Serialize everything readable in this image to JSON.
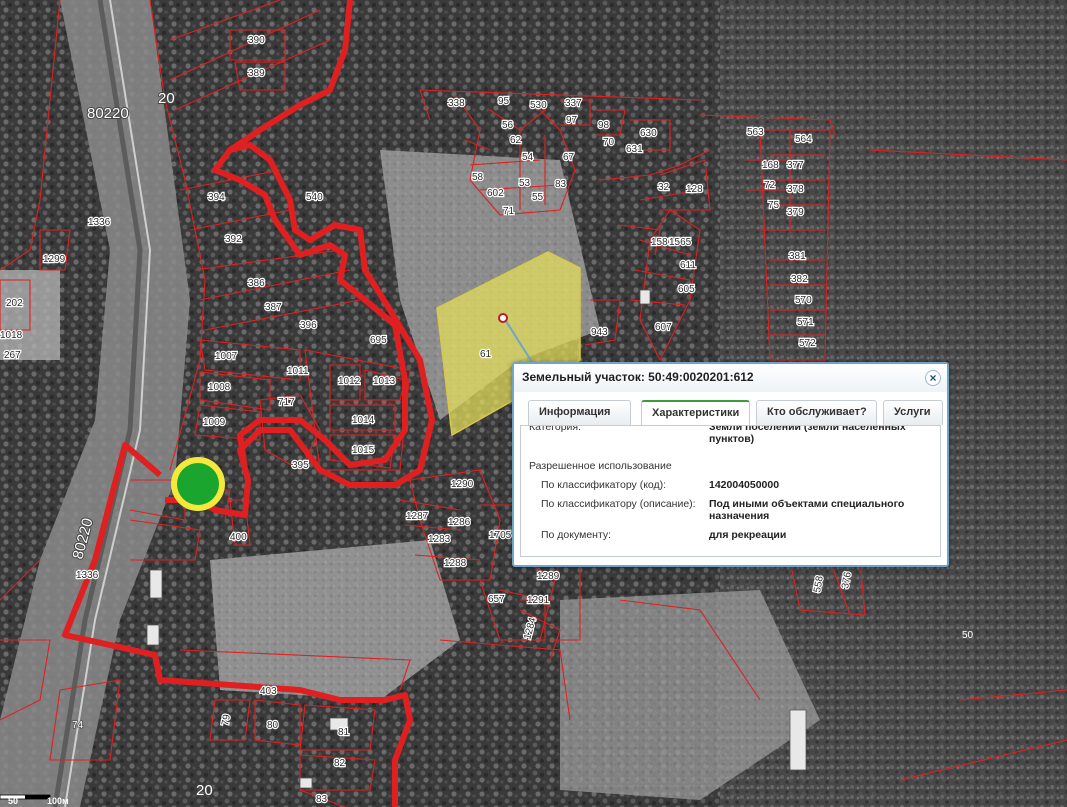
{
  "map": {
    "labels": {
      "l80220a": "80220",
      "l80220b": "80220",
      "r20a": "20",
      "r20b": "20",
      "p390": "390",
      "p389": "389",
      "p394": "394",
      "p392": "392",
      "p386": "386",
      "p387": "387",
      "p396": "396",
      "p540": "540",
      "p695": "695",
      "p1007": "1007",
      "p1008": "1008",
      "p1009": "1009",
      "p1011": "1011",
      "p1012": "1012",
      "p1013": "1013",
      "p1014": "1014",
      "p1015": "1015",
      "p717": "717",
      "p395": "395",
      "p400": "400",
      "p1336a": "1336",
      "p1336b": "1336",
      "p1299": "1299",
      "p1018": "1018",
      "p267": "267",
      "p202": "202",
      "p338": "338",
      "p95": "95",
      "p530": "530",
      "p337": "337",
      "p97": "97",
      "p98": "98",
      "p630": "630",
      "p631": "631",
      "p70": "70",
      "p56": "56",
      "p62": "62",
      "p54": "54",
      "p67": "67",
      "p58": "58",
      "p602": "602",
      "p53": "53",
      "p83": "83",
      "p71": "71",
      "p55": "55",
      "p563": "563",
      "p564": "564",
      "p168": "168",
      "p377": "377",
      "p72": "72",
      "p378": "378",
      "p75": "75",
      "p379": "379",
      "p128": "128",
      "p32": "32",
      "p611": "611",
      "p605": "605",
      "p607": "607",
      "p1586": "1586",
      "p1565": "1565",
      "p943": "943",
      "p381": "381",
      "p382": "382",
      "p570": "570",
      "p571": "571",
      "p572": "572",
      "p1290": "1290",
      "p1287": "1287",
      "p1286": "1286",
      "p1283": "1283",
      "p1288": "1288",
      "p1705": "1705",
      "p1289": "1289",
      "p657": "657",
      "p1291": "1291",
      "p1284": "1284",
      "p558": "558",
      "p376": "376",
      "p50": "50",
      "p403": "403",
      "p74": "74",
      "p79": "79",
      "p80": "80",
      "p81": "81",
      "p82": "82",
      "p83b": "83",
      "p612": "61"
    },
    "scale": {
      "zero": "50",
      "dist": "100м"
    },
    "colors": {
      "boundary": "#e02020",
      "selected": "#e8e05a",
      "marker_fill": "#1aa52f",
      "marker_ring": "#f3e93a"
    }
  },
  "popup": {
    "title": "Земельный участок: 50:49:0020201:612",
    "close_icon": "close-icon",
    "tabs": [
      "Информация",
      "Характеристики",
      "Кто обслуживает?",
      "Услуги"
    ],
    "active_tab": "Характеристики",
    "category_key": "Категория:",
    "category_value": "Земли поселений (земли населенных пунктов)",
    "section_title": "Разрешенное использование",
    "rows": [
      {
        "key": "По классификатору (код):",
        "value": "142004050000"
      },
      {
        "key": "По классификатору (описание):",
        "value": "Под иными объектами специального назначения"
      },
      {
        "key": "По документу:",
        "value": "для рекреации"
      }
    ]
  }
}
